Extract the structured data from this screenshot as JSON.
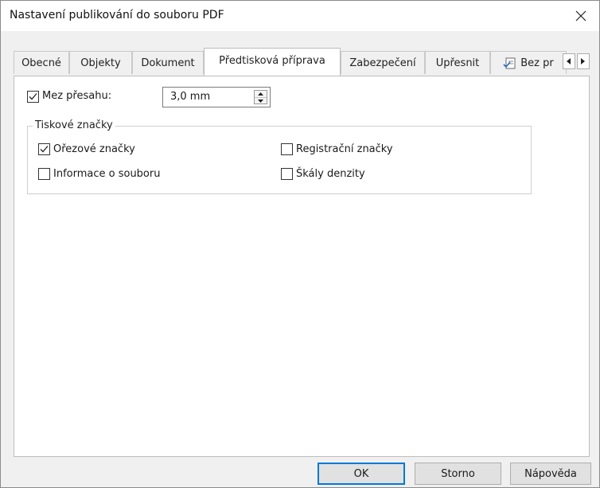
{
  "window": {
    "title": "Nastavení publikování do souboru PDF"
  },
  "tabs": [
    {
      "label": "Obecné"
    },
    {
      "label": "Objekty"
    },
    {
      "label": "Dokument"
    },
    {
      "label": "Předtisková příprava",
      "active": true
    },
    {
      "label": "Zabezpečení"
    },
    {
      "label": "Upřesnit"
    },
    {
      "label": "Bez pr",
      "icon": "checklist-icon"
    }
  ],
  "prepress": {
    "bleed": {
      "label": "Mez přesahu:",
      "checked": true,
      "value": "3,0 mm"
    },
    "print_marks": {
      "title": "Tiskové značky",
      "options": [
        {
          "label": "Ořezové značky",
          "checked": true
        },
        {
          "label": "Registrační značky",
          "checked": false
        },
        {
          "label": "Informace o souboru",
          "checked": false
        },
        {
          "label": "Škály denzity",
          "checked": false
        }
      ]
    }
  },
  "buttons": {
    "ok": "OK",
    "cancel": "Storno",
    "help": "Nápověda"
  },
  "colors": {
    "default_button_border": "#0078d7",
    "panel_background": "#ffffff",
    "dialog_background": "#f0f0f0"
  }
}
